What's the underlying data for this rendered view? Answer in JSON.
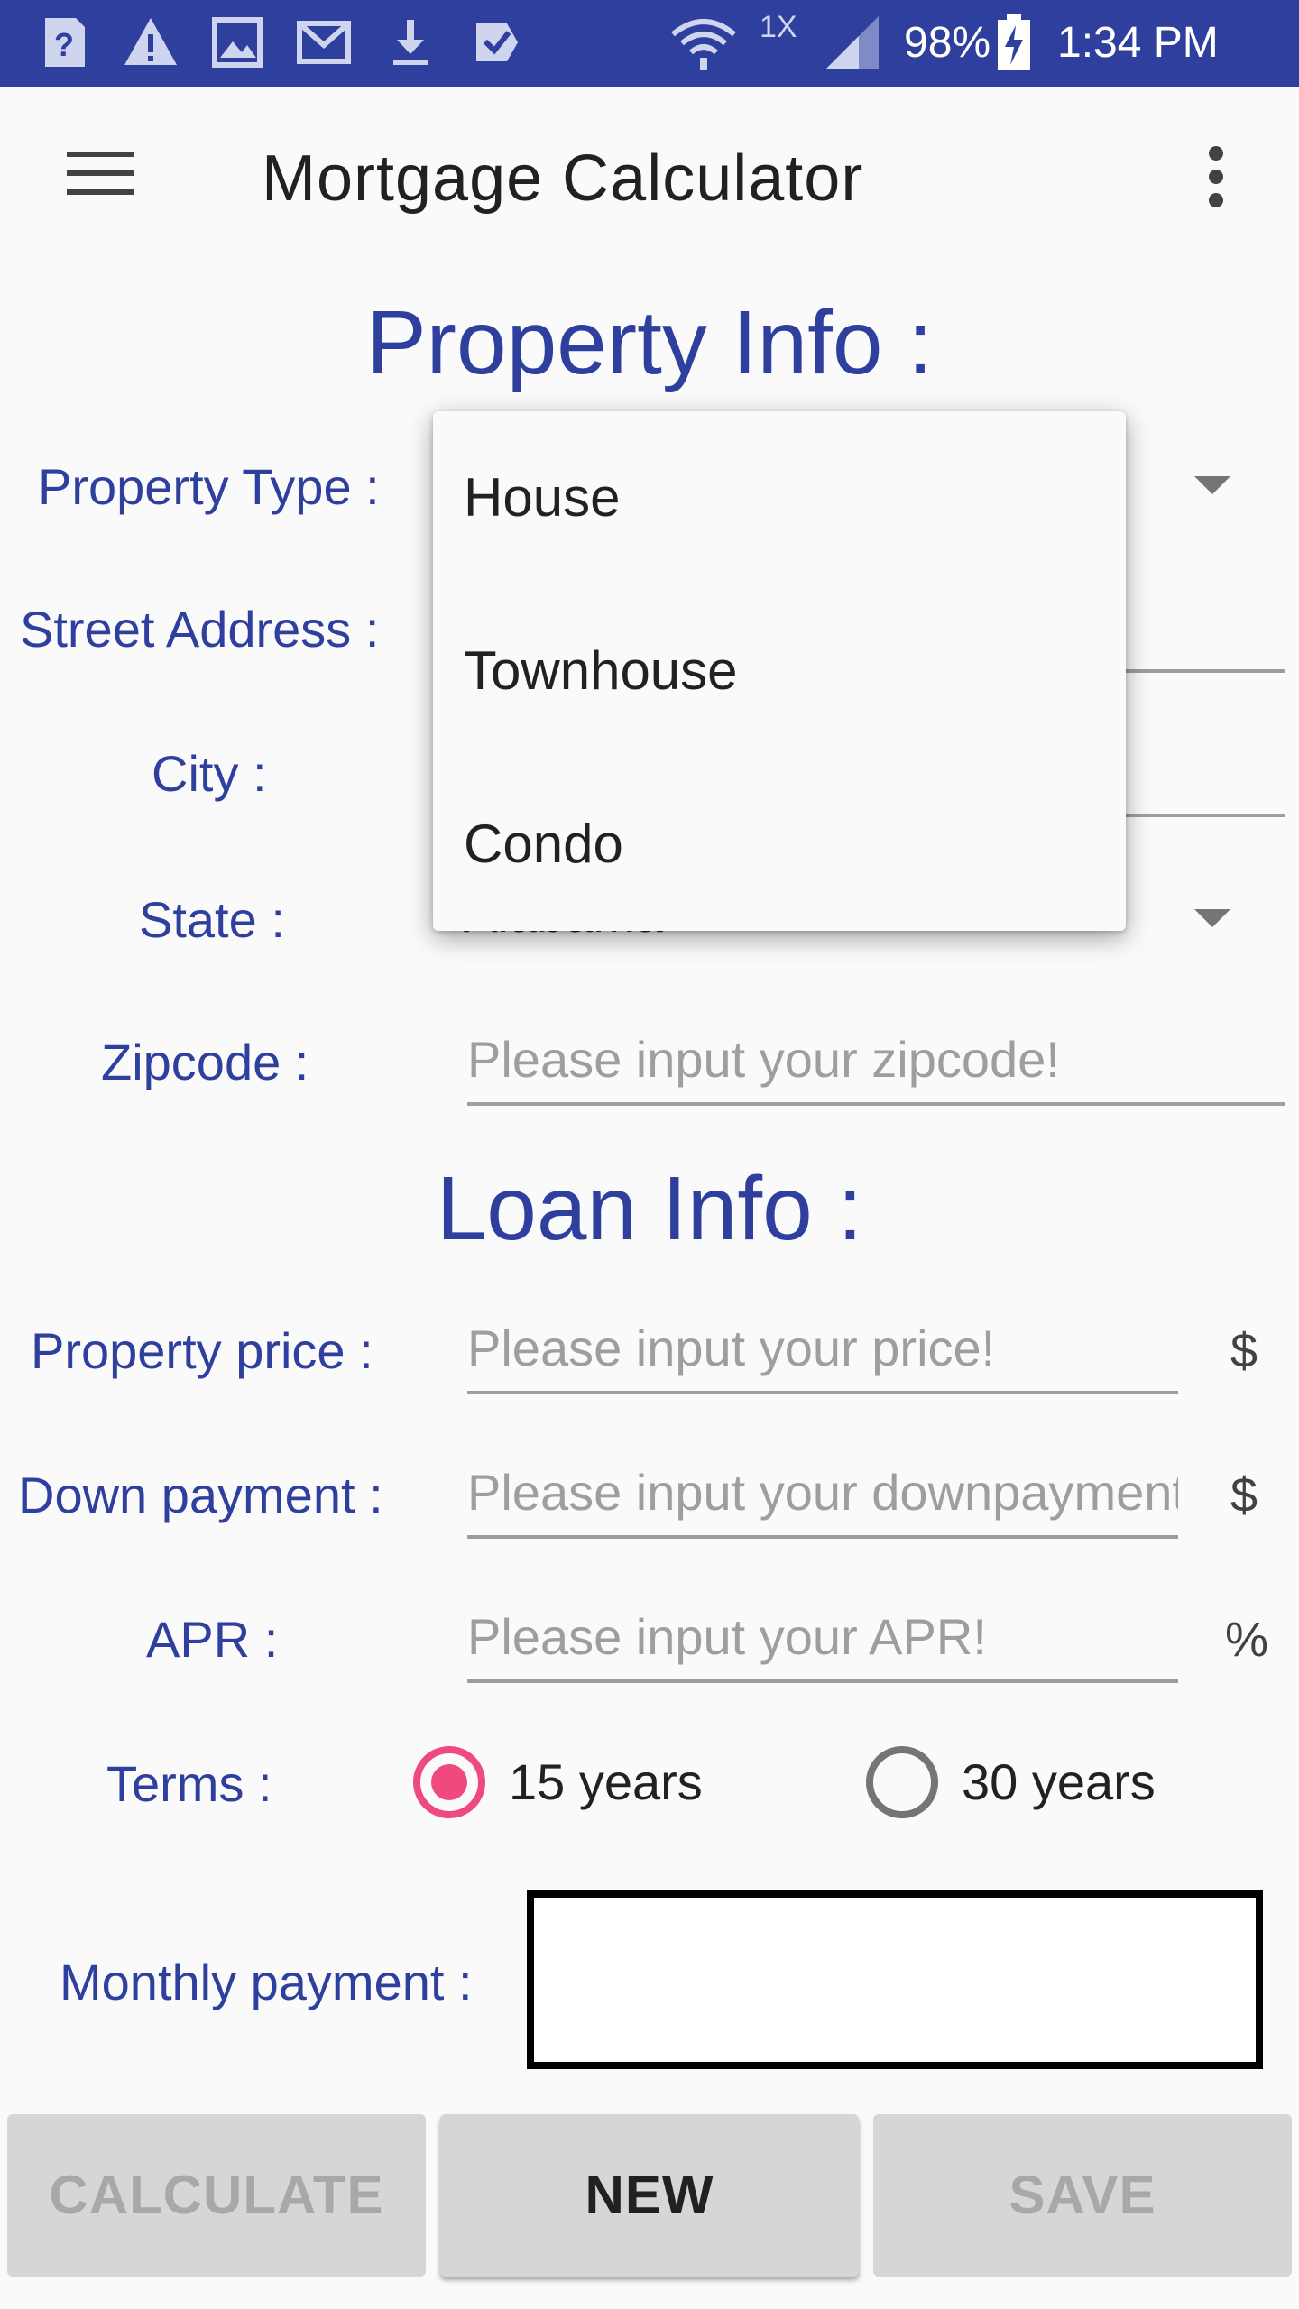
{
  "status_bar": {
    "network_type": "1X",
    "battery": "98%",
    "time": "1:34 PM",
    "icons": [
      "help-icon",
      "warning-icon",
      "image-icon",
      "gmail-icon",
      "download-icon",
      "task-icon",
      "wifi-icon",
      "signal-icon",
      "battery-charging-icon"
    ]
  },
  "app_bar": {
    "title": "Mortgage Calculator",
    "menu_icon": "hamburger-menu-icon",
    "overflow_icon": "more-vert-icon"
  },
  "property_info": {
    "heading": "Property Info :",
    "property_type_label": "Property Type :",
    "street_address_label": "Street Address :",
    "city_label": "City :",
    "state_label": "State :",
    "state_value": "Alabama",
    "zipcode_label": "Zipcode :",
    "zipcode_placeholder": "Please input your zipcode!"
  },
  "property_type_dropdown": {
    "options": [
      "House",
      "Townhouse",
      "Condo"
    ]
  },
  "loan_info": {
    "heading": "Loan Info :",
    "price_label": "Property price :",
    "price_placeholder": "Please input your price!",
    "price_unit": "$",
    "down_label": "Down payment :",
    "down_placeholder": "Please input your downpayment!",
    "down_unit": "$",
    "apr_label": "APR :",
    "apr_placeholder": "Please input your APR!",
    "apr_unit": "%",
    "terms_label": "Terms :",
    "terms_options": [
      {
        "label": "15 years",
        "checked": true
      },
      {
        "label": "30 years",
        "checked": false
      }
    ],
    "monthly_label": "Monthly payment :",
    "monthly_value": ""
  },
  "buttons": {
    "calculate": "CALCULATE",
    "new": "NEW",
    "save": "SAVE"
  },
  "colors": {
    "accent_blue": "#2f3f9e",
    "radio_pink": "#ef4a7e"
  }
}
